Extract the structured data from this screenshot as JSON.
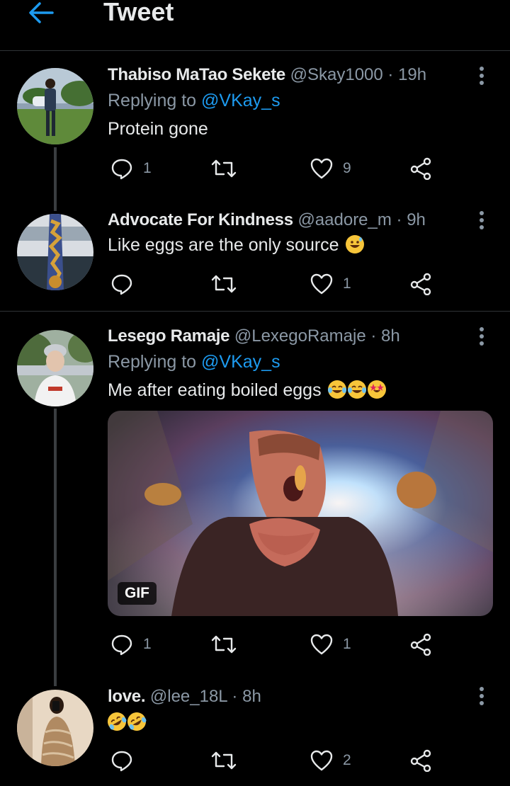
{
  "header": {
    "title": "Tweet"
  },
  "tweets": [
    {
      "name": "Thabiso MaTao Sekete",
      "handle": "@Skay1000 · 19h",
      "replying_prefix": "Replying to ",
      "replying_to": "@VKay_s",
      "text": "Protein gone",
      "reply_count": "1",
      "retweet_count": "",
      "like_count": "9"
    },
    {
      "name": "Advocate For Kindness",
      "handle": "@aadore_m · 9h",
      "text": "Like eggs are the only source",
      "emoji": [
        "grinning-sweat-emoji"
      ],
      "reply_count": "",
      "retweet_count": "",
      "like_count": "1"
    },
    {
      "name": "Lesego Ramaje",
      "handle": "@LexegoRamaje · 8h",
      "replying_prefix": "Replying to ",
      "replying_to": "@VKay_s",
      "text": "Me after eating boiled eggs",
      "emoji": [
        "tears-of-joy-emoji",
        "tears-of-joy-emoji",
        "star-struck-emoji"
      ],
      "gif_badge": "GIF",
      "reply_count": "1",
      "retweet_count": "",
      "like_count": "1"
    },
    {
      "name": "love.",
      "handle": "@lee_18L · 8h",
      "text": "",
      "emoji": [
        "rolling-laughing-emoji",
        "rolling-laughing-emoji"
      ],
      "reply_count": "",
      "retweet_count": "",
      "like_count": "2"
    }
  ],
  "colors": {
    "accent": "#1d9bf0",
    "muted": "#8b98a5",
    "background": "#000000"
  }
}
